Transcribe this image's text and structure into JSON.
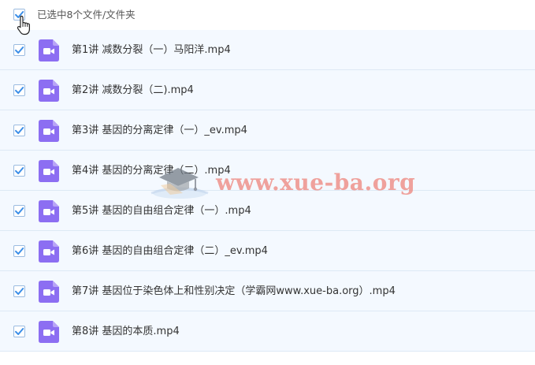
{
  "header": {
    "selection_label": "已选中8个文件/文件夹",
    "checked": true
  },
  "files": [
    {
      "name": "第1讲 减数分裂（一）马阳洋.mp4",
      "checked": true,
      "icon": "video-file-icon"
    },
    {
      "name": "第2讲 减数分裂（二).mp4",
      "checked": true,
      "icon": "video-file-icon"
    },
    {
      "name": "第3讲 基因的分离定律（一）_ev.mp4",
      "checked": true,
      "icon": "video-file-icon"
    },
    {
      "name": "第4讲 基因的分离定律（二）.mp4",
      "checked": true,
      "icon": "video-file-icon"
    },
    {
      "name": "第5讲 基因的自由组合定律（一）.mp4",
      "checked": true,
      "icon": "video-file-icon"
    },
    {
      "name": "第6讲 基因的自由组合定律（二）_ev.mp4",
      "checked": true,
      "icon": "video-file-icon"
    },
    {
      "name": "第7讲 基因位于染色体上和性别决定（学霸网www.xue-ba.org）.mp4",
      "checked": true,
      "icon": "video-file-icon"
    },
    {
      "name": "第8讲 基因的本质.mp4",
      "checked": true,
      "icon": "video-file-icon"
    }
  ],
  "watermark": {
    "text": "www.xue-ba.org"
  },
  "colors": {
    "check": "#3b8ee8",
    "row_bg": "#f4f9ff",
    "row_border": "#dde9f5",
    "video_icon": "#8c6ef2",
    "watermark": "#ee786e"
  }
}
